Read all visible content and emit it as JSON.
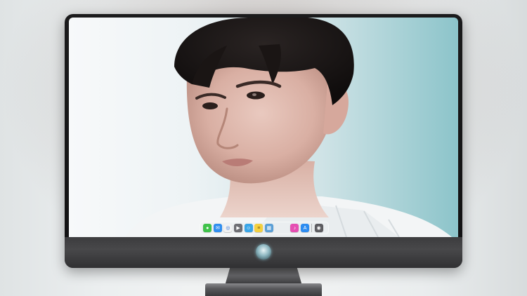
{
  "desktop": {
    "wallpaper_description_icon": "portrait-wallpaper-icon",
    "accent_colors": {
      "wallpaper_left": "#f6f8f9",
      "wallpaper_right": "#8fc7cc",
      "bezel": "#141415",
      "chin": "#3f3f41"
    }
  },
  "dock": {
    "apps": [
      {
        "icon": "messages-icon",
        "color": "#3fc24a",
        "glyph": "●"
      },
      {
        "icon": "mail-icon",
        "color": "#2f8ef0",
        "glyph": "✉"
      },
      {
        "icon": "safari-icon",
        "color": "#f2f2f2",
        "glyph": "◎"
      },
      {
        "icon": "imovie-icon",
        "color": "#6e6e73",
        "glyph": "▶"
      },
      {
        "icon": "finder-icon",
        "color": "#3aa6e8",
        "glyph": "☺"
      },
      {
        "icon": "notes-icon",
        "color": "#f4d03f",
        "glyph": "≡"
      },
      {
        "icon": "preview-icon",
        "color": "#5a9fd6",
        "glyph": "▦"
      },
      {
        "icon": "itunes-icon",
        "color": "#e54fb2",
        "glyph": "♪"
      },
      {
        "icon": "app-store-icon",
        "color": "#2d8cf0",
        "glyph": "A"
      },
      {
        "icon": "camera-icon",
        "color": "#5c5c60",
        "glyph": "◉"
      }
    ]
  }
}
